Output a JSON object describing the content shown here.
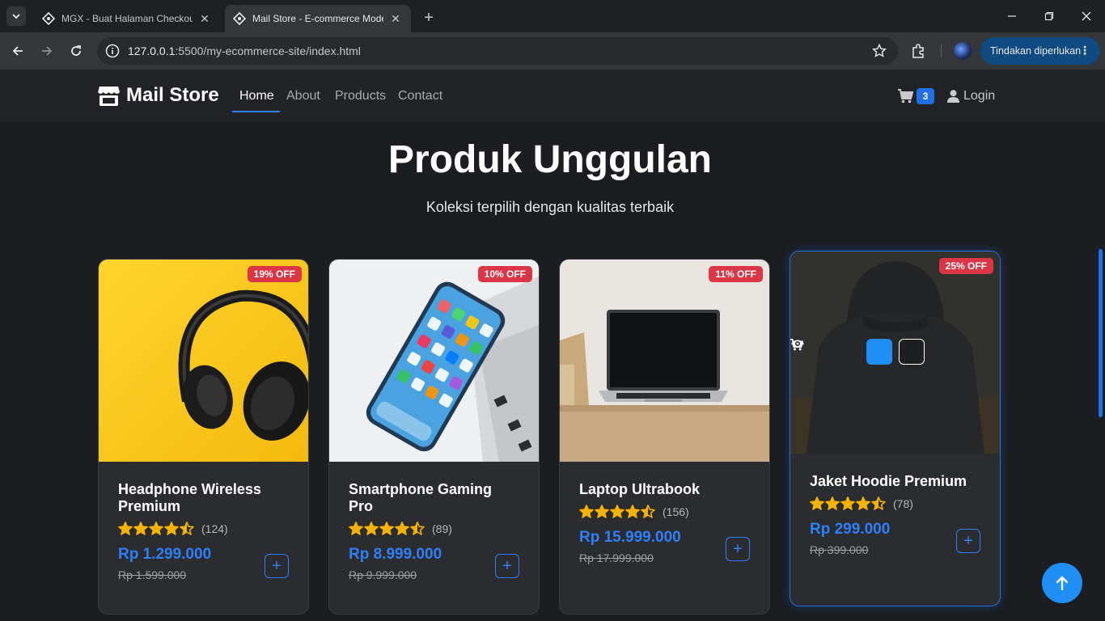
{
  "browser": {
    "tabs": [
      {
        "title": "MGX - Buat Halaman Checkout",
        "active": false
      },
      {
        "title": "Mail Store - E-commerce Mode",
        "active": true
      }
    ],
    "url_host": "127.0.0.1",
    "url_path": ":5500/my-ecommerce-site/index.html",
    "action_chip": "Tindakan diperlukan"
  },
  "nav": {
    "brand": "Mail Store",
    "links": [
      "Home",
      "About",
      "Products",
      "Contact"
    ],
    "active_link": "Home",
    "cart_count": "3",
    "login": "Login"
  },
  "hero": {
    "title": "Produk Unggulan",
    "subtitle": "Koleksi terpilih dengan kualitas terbaik"
  },
  "products": [
    {
      "name": "Headphone Wireless Premium",
      "discount": "19% OFF",
      "reviews": "(124)",
      "rating": 4.5,
      "price": "Rp 1.299.000",
      "old_price": "Rp 1.599.000",
      "image": "headphone-image"
    },
    {
      "name": "Smartphone Gaming Pro",
      "discount": "10% OFF",
      "reviews": "(89)",
      "rating": 4.5,
      "price": "Rp 8.999.000",
      "old_price": "Rp 9.999.000",
      "image": "smartphone-image"
    },
    {
      "name": "Laptop Ultrabook",
      "discount": "11% OFF",
      "reviews": "(156)",
      "rating": 4.5,
      "price": "Rp 15.999.000",
      "old_price": "Rp 17.999.000",
      "image": "laptop-image"
    },
    {
      "name": "Jaket Hoodie Premium",
      "discount": "25% OFF",
      "reviews": "(78)",
      "rating": 4.5,
      "price": "Rp 299.000",
      "old_price": "Rp 399.000",
      "image": "hoodie-image"
    }
  ],
  "colors": {
    "accent": "#1f6fe8",
    "discount_badge": "#dc3545",
    "star": "#f5b301",
    "page_bg": "#1b1d20"
  }
}
